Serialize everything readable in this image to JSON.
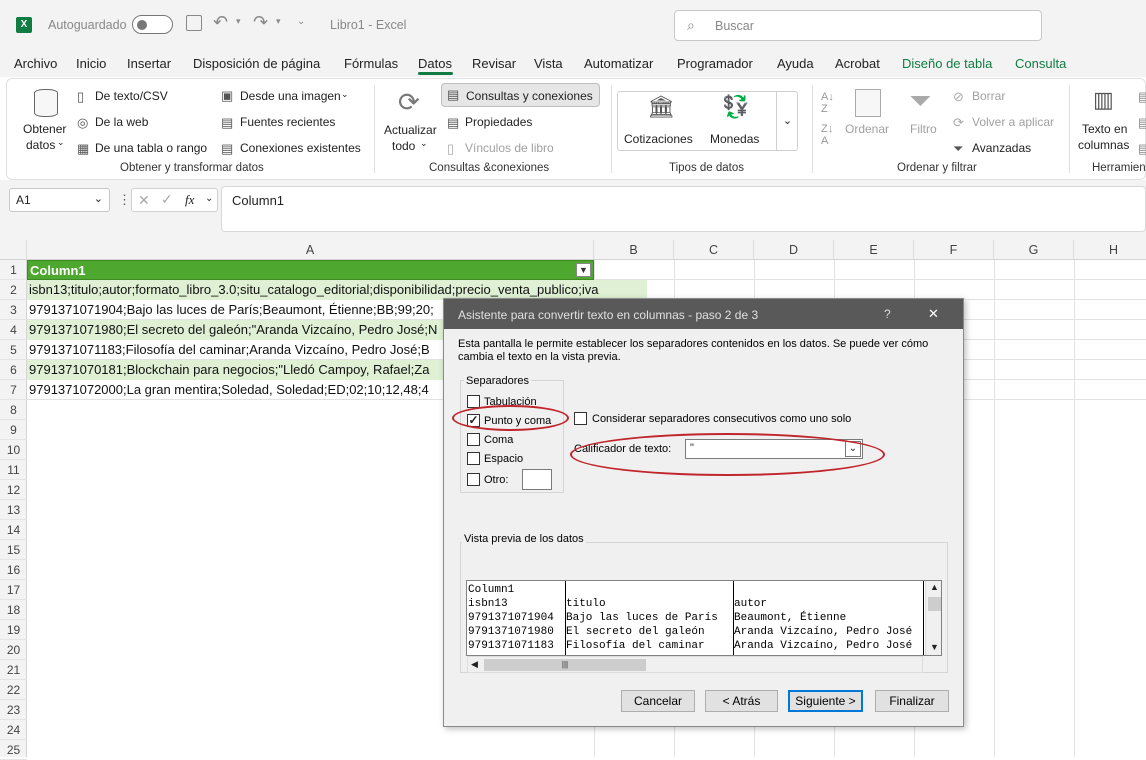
{
  "titlebar": {
    "autosave_label": "Autoguardado",
    "doc_title": "Libro1 - Excel",
    "search_placeholder": "Buscar"
  },
  "menu": [
    "Archivo",
    "Inicio",
    "Insertar",
    "Disposición de página",
    "Fórmulas",
    "Datos",
    "Revisar",
    "Vista",
    "Automatizar",
    "Programador",
    "Ayuda",
    "Acrobat",
    "Diseño de tabla",
    "Consulta"
  ],
  "ribbon": {
    "get_data": {
      "label1": "Obtener",
      "label2": "datos"
    },
    "from_text": "De texto/CSV",
    "from_web": "De la web",
    "from_table": "De una tabla o rango",
    "from_image": "Desde una imagen",
    "recent_sources": "Fuentes recientes",
    "existing_connections": "Conexiones existentes",
    "group1": "Obtener y transformar datos",
    "refresh_all": {
      "label1": "Actualizar",
      "label2": "todo"
    },
    "queries_connections": "Consultas y conexiones",
    "properties": "Propiedades",
    "book_links": "Vínculos de libro",
    "group2": "Consultas &conexiones",
    "stocks": "Cotizaciones",
    "currencies": "Monedas",
    "group3": "Tipos de datos",
    "sort": "Ordenar",
    "filter": "Filtro",
    "clear": "Borrar",
    "reapply": "Volver a aplicar",
    "advanced": "Avanzadas",
    "group4": "Ordenar y filtrar",
    "text_to_columns": {
      "label1": "Texto en",
      "label2": "columnas"
    },
    "group5": "Herramien"
  },
  "formula_bar": {
    "name_box": "A1",
    "fx": "fx",
    "content": "Column1"
  },
  "columns": [
    "A",
    "B",
    "C",
    "D",
    "E",
    "F",
    "G",
    "H"
  ],
  "rows": [
    "1",
    "2",
    "3",
    "4",
    "5",
    "6",
    "7",
    "8",
    "9",
    "10",
    "11",
    "12",
    "13",
    "14",
    "15",
    "16",
    "17",
    "18",
    "19",
    "20",
    "21",
    "22",
    "23",
    "24",
    "25"
  ],
  "cells": [
    "Column1",
    "isbn13;titulo;autor;formato_libro_3.0;situ_catalogo_editorial;disponibilidad;precio_venta_publico;iva",
    "9791371071904;Bajo las luces de París;Beaumont, Étienne;BB;99;20;",
    "9791371071980;El secreto del galeón;\"Aranda Vizcaíno, Pedro José;N",
    "9791371071183;Filosofía del caminar;Aranda Vizcaíno, Pedro José;B",
    "9791371070181;Blockchain para negocios;\"Lledó Campoy, Rafael;Za",
    "9791371072000;La gran mentira;Soledad, Soledad;ED;02;10;12,48;4"
  ],
  "dialog": {
    "title": "Asistente para convertir texto en columnas - paso 2 de 3",
    "help": "?",
    "close": "✕",
    "intro1": "Esta pantalla le permite establecer los separadores contenidos en los datos. Se puede ver cómo",
    "intro2": "cambia el texto en la vista previa.",
    "separators_label": "Separadores",
    "tab": "Tabulación",
    "semicolon": "Punto y coma",
    "comma": "Coma",
    "space": "Espacio",
    "other": "Otro:",
    "consecutive": "Considerar separadores consecutivos como uno solo",
    "qualifier_label": "Calificador de texto:",
    "qualifier_value": "\"",
    "preview_label": "Vista previa de los datos",
    "preview_col1": [
      "Column1",
      "isbn13",
      "9791371071904",
      "9791371071980",
      "9791371071183"
    ],
    "preview_col2": [
      "",
      "titulo",
      "Bajo las luces de París",
      "El secreto del galeón",
      "Filosofía del caminar"
    ],
    "preview_col3": [
      "",
      "autor",
      "Beaumont, Étienne",
      "Aranda Vizcaíno, Pedro José",
      "Aranda Vizcaíno, Pedro José"
    ],
    "cancel": "Cancelar",
    "back": "< Atrás",
    "next": "Siguiente >",
    "finish": "Finalizar"
  }
}
